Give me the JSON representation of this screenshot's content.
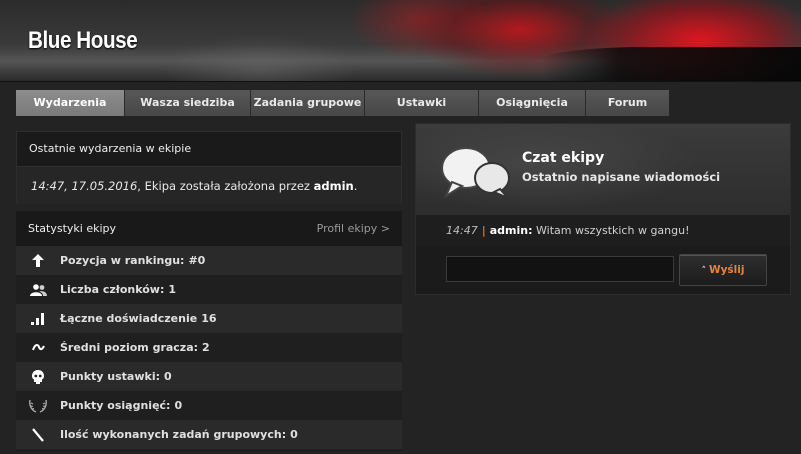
{
  "header": {
    "title": "Blue House"
  },
  "nav": {
    "tabs": [
      {
        "label": "Wydarzenia",
        "active": true
      },
      {
        "label": "Wasza siedziba",
        "active": false
      },
      {
        "label": "Zadania grupowe",
        "active": false
      },
      {
        "label": "Ustawki",
        "active": false
      },
      {
        "label": "Osiągnięcia",
        "active": false
      },
      {
        "label": "Forum",
        "active": false
      }
    ]
  },
  "events": {
    "heading": "Ostatnie wydarzenia w ekipie",
    "entry": {
      "time": "14:47, 17.05.2016",
      "text": ", Ekipa została założona przez ",
      "user": "admin",
      "end": "."
    }
  },
  "stats": {
    "heading": "Statystyki ekipy",
    "profile_link": "Profil ekipy >",
    "rows": [
      {
        "icon": "arrow-up-icon",
        "label": "Pozycja w rankingu:",
        "value": "#0"
      },
      {
        "icon": "users-icon",
        "label": "Liczba członków:",
        "value": "1"
      },
      {
        "icon": "signal-bars-icon",
        "label": "Łączne doświadczenie",
        "value": "16"
      },
      {
        "icon": "tilde-icon",
        "label": "Średni poziom gracza:",
        "value": "2"
      },
      {
        "icon": "skull-icon",
        "label": "Punkty ustawki:",
        "value": "0"
      },
      {
        "icon": "laurel-icon",
        "label": "Punkty osiągnięć:",
        "value": "0"
      },
      {
        "icon": "slash-icon",
        "label": "Ilość wykonanych zadań grupowych:",
        "value": "0"
      }
    ]
  },
  "chat": {
    "title": "Czat ekipy",
    "subtitle": "Ostatnio napisane wiadomości",
    "message": {
      "time": "14:47",
      "separator": "|",
      "user": "admin:",
      "text": " Witam wszystkich w gangu!"
    },
    "input_value": "",
    "input_placeholder": "",
    "send_label": "Wyślij",
    "send_caret": "˄"
  },
  "colors": {
    "accent": "#e9833b",
    "active_tab": "#8d8d8d",
    "tab": "#4f4f4f"
  }
}
